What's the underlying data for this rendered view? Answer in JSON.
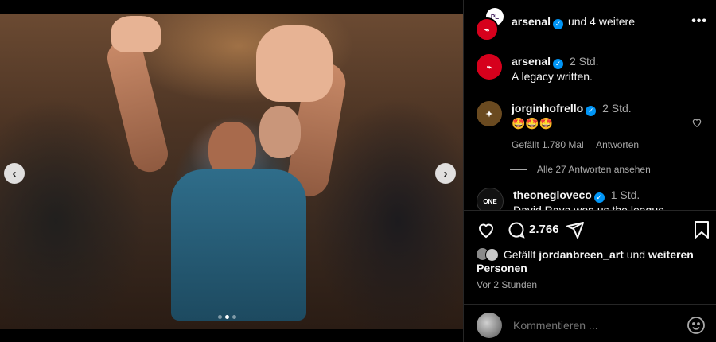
{
  "post_header": {
    "username": "arsenal",
    "coauthors": "und 4 weitere",
    "more_icon": "more-horizontal-icon"
  },
  "caption": {
    "username": "arsenal",
    "time": "2 Std.",
    "text": "A legacy written."
  },
  "comments": [
    {
      "username": "jorginhofrello",
      "time": "2 Std.",
      "text": "🤩🤩🤩",
      "likes": "Gefällt 1.780 Mal",
      "reply_label": "Antworten",
      "view_replies": "Alle 27 Antworten ansehen"
    },
    {
      "username": "theonegloveco",
      "time": "1 Std.",
      "text": "David Raya won us the league"
    }
  ],
  "actions": {
    "comment_count": "2.766",
    "icons": [
      "heart-icon",
      "comment-icon",
      "share-icon",
      "bookmark-icon"
    ]
  },
  "likes": {
    "prefix": "Gefällt",
    "user": "jordanbreen_art",
    "middle": "und",
    "others": "weiteren Personen"
  },
  "timestamp": "Vor 2 Stunden",
  "input": {
    "placeholder": "Kommentieren ..."
  },
  "carousel": {
    "prev": "‹",
    "next": "›",
    "dots": 3,
    "active_dot": 1
  },
  "colors": {
    "verified": "#0095f6",
    "arsenal_red": "#d6001c",
    "muted": "#a8a8a8"
  }
}
